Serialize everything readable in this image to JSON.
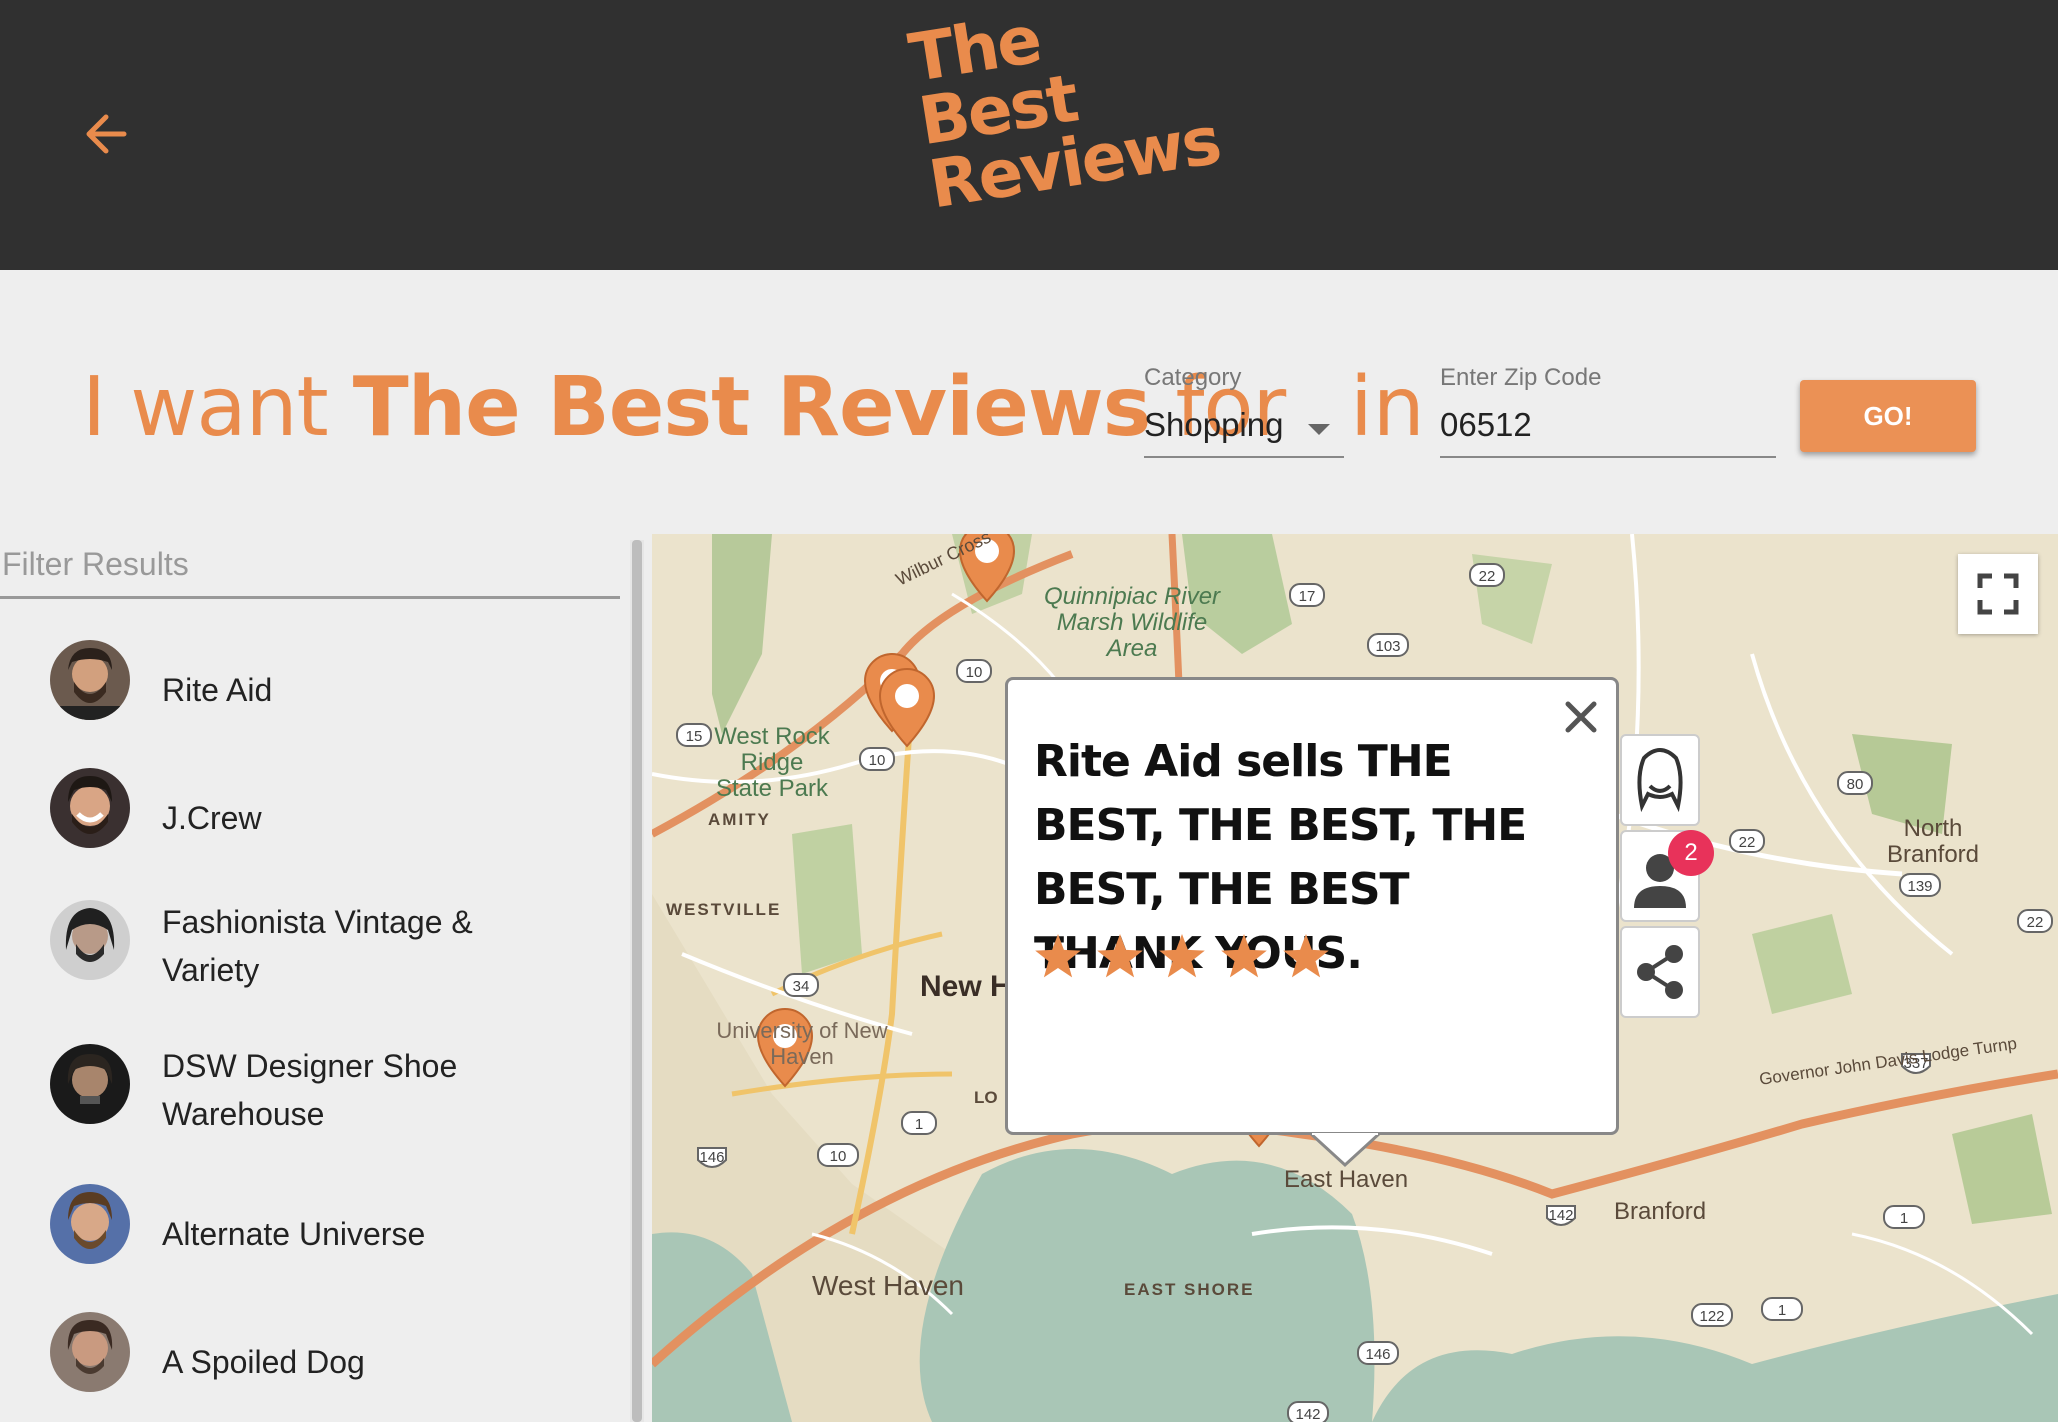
{
  "header": {
    "logo_lines": [
      "The",
      "Best",
      "Reviews"
    ]
  },
  "search": {
    "headline_prefix": "I want ",
    "headline_brand": "The Best Reviews",
    "headline_for": " for",
    "in_word": "in",
    "category_label": "Category",
    "category_value": "Shopping",
    "zip_label": "Enter Zip Code",
    "zip_value": "06512",
    "go_label": "GO!"
  },
  "filter": {
    "placeholder": "Filter Results"
  },
  "results": [
    {
      "label": "Rite Aid"
    },
    {
      "label": "J.Crew"
    },
    {
      "label": "Fashionista Vintage & Variety"
    },
    {
      "label": "DSW Designer Shoe Warehouse"
    },
    {
      "label": "Alternate Universe"
    },
    {
      "label": "A Spoiled Dog"
    }
  ],
  "popup": {
    "text": "Rite Aid sells THE BEST, THE BEST, THE BEST, THE BEST THANK YOUS.",
    "rating": 5,
    "rating_max": 5,
    "star_color": "#e98b4c"
  },
  "side_buttons": {
    "badge_count": "2"
  },
  "map_labels": {
    "wilbur": "Wilbur Cross",
    "quinnipiac": "Quinnipiac River Marsh Wildlife Area",
    "west_rock": "West Rock Ridge State Park",
    "amity": "AMITY",
    "westville": "WESTVILLE",
    "new_haven": "New H",
    "university": "University of New Haven",
    "lo": "LO",
    "east_haven": "East Haven",
    "west_haven": "West Haven",
    "east_shore": "EAST SHORE",
    "north_branford": "North Branford",
    "branford": "Branford",
    "governor": "Governor John Davis Lodge Turnp",
    "shields": [
      "22",
      "17",
      "103",
      "10",
      "15",
      "10",
      "80",
      "22",
      "139",
      "22",
      "34",
      "1",
      "10",
      "1",
      "122",
      "1",
      "146",
      "142",
      "146",
      "142",
      "337"
    ]
  },
  "colors": {
    "accent": "#e98b4c",
    "header_bg": "#303030",
    "badge": "#e8325a"
  }
}
